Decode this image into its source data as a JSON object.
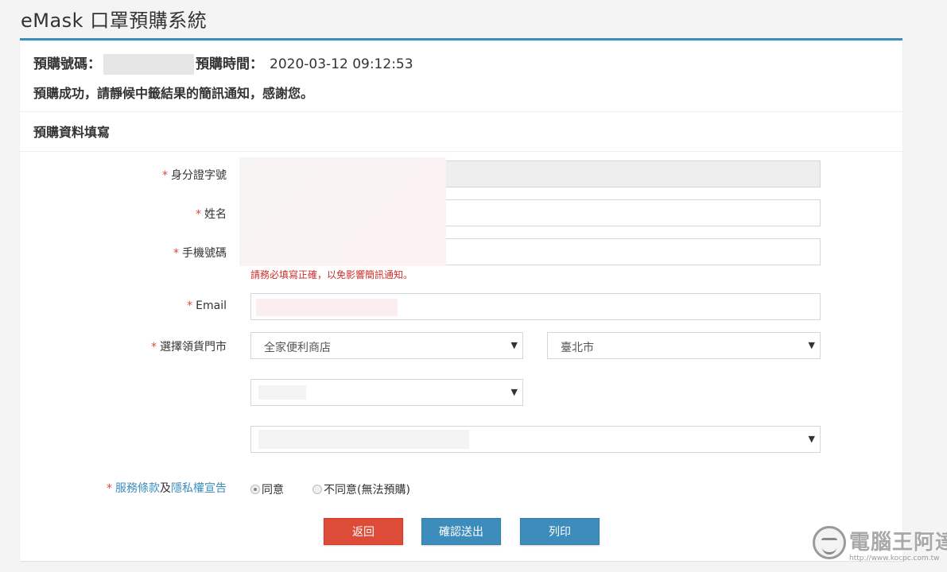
{
  "app": {
    "title": "eMask 口罩預購系統"
  },
  "order": {
    "number_label": "預購號碼：",
    "time_label": "預購時間：",
    "time_value": "2020-03-12 09:12:53",
    "message": "預購成功，請靜候中籤結果的簡訊通知，感謝您。"
  },
  "section": {
    "title": "預購資料填寫"
  },
  "form": {
    "required_mark": "*",
    "id_label": "身分證字號",
    "name_label": "姓名",
    "phone_label": "手機號碼",
    "phone_hint": "請務必填寫正確，以免影響簡訊通知。",
    "email_label": "Email",
    "store_label": "選擇領貨門市",
    "store_chain": "全家便利商店",
    "city": "臺北市",
    "caret": "▼"
  },
  "terms": {
    "link1": "服務條款",
    "joiner": "及",
    "link2": "隱私權宣告",
    "agree": "同意",
    "disagree": "不同意(無法預購)"
  },
  "buttons": {
    "back": "返回",
    "confirm": "確認送出",
    "print": "列印"
  },
  "watermark": {
    "text": "電腦王阿達",
    "url": "http://www.kocpc.com.tw"
  },
  "colors": {
    "accent": "#3c8dbc",
    "danger": "#dd4b39"
  }
}
